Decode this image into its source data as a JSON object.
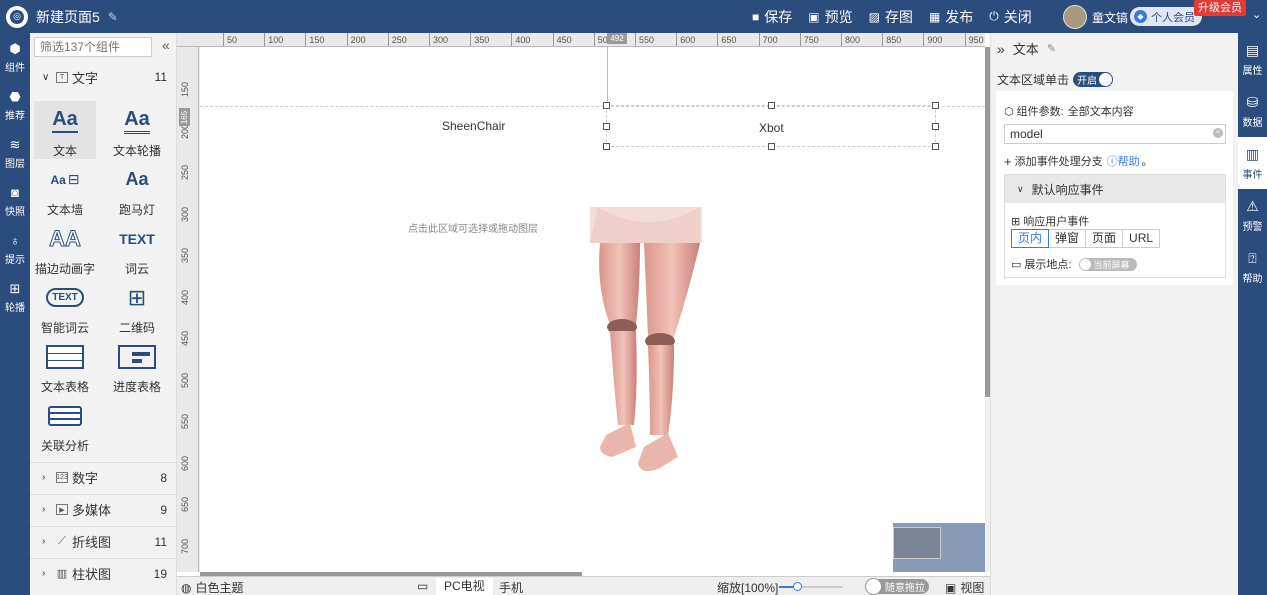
{
  "topbar": {
    "title": "新建页面5",
    "actions": [
      {
        "label": "保存",
        "icon": "save-icon"
      },
      {
        "label": "预览",
        "icon": "preview-icon"
      },
      {
        "label": "存图",
        "icon": "image-icon"
      },
      {
        "label": "发布",
        "icon": "publish-icon"
      },
      {
        "label": "关闭",
        "icon": "power-icon"
      }
    ],
    "user_name": "童文镐",
    "member_label": "个人会员",
    "upgrade_label": "升级会员"
  },
  "left_rail": [
    {
      "label": "组件",
      "icon": "component-icon"
    },
    {
      "label": "推荐",
      "icon": "recommend-icon"
    },
    {
      "label": "图层",
      "icon": "layers-icon"
    },
    {
      "label": "快照",
      "icon": "camera-icon"
    },
    {
      "label": "提示",
      "icon": "bulb-icon"
    },
    {
      "label": "轮播",
      "icon": "grid-icon"
    }
  ],
  "components": {
    "search_placeholder": "筛选137个组件",
    "expanded_category": {
      "label": "文字",
      "count": "11"
    },
    "items": [
      {
        "label": "文本",
        "glyph": "Aa"
      },
      {
        "label": "文本轮播",
        "glyph": "Aa"
      },
      {
        "label": "文本墙",
        "glyph": "Aa"
      },
      {
        "label": "跑马灯",
        "glyph": "Aa"
      },
      {
        "label": "描边动画字",
        "glyph": "AA"
      },
      {
        "label": "词云",
        "glyph": "TEXT"
      },
      {
        "label": "智能词云",
        "glyph": "TEXT"
      },
      {
        "label": "二维码",
        "glyph": "QR"
      },
      {
        "label": "文本表格",
        "glyph": ""
      },
      {
        "label": "进度表格",
        "glyph": ""
      },
      {
        "label": "关联分析",
        "glyph": ""
      }
    ],
    "collapsed_categories": [
      {
        "label": "数字",
        "count": "8"
      },
      {
        "label": "多媒体",
        "count": "9"
      },
      {
        "label": "折线图",
        "count": "11"
      },
      {
        "label": "柱状图",
        "count": "19"
      }
    ]
  },
  "rulers": {
    "top_labels": [
      "50",
      "100",
      "150",
      "200",
      "250",
      "300",
      "350",
      "400",
      "450",
      "500",
      "550",
      "600",
      "650",
      "700",
      "750",
      "800",
      "850",
      "900",
      "950"
    ],
    "left_labels": [
      "150",
      "200",
      "250",
      "300",
      "350",
      "400",
      "450",
      "500",
      "550",
      "600",
      "650",
      "700"
    ],
    "top_marker": "492",
    "left_marker": "165"
  },
  "canvas": {
    "text_left": "SheenChair",
    "text_right": "Xbot",
    "hint": "点击此区域可选择或拖动图层"
  },
  "statusbar": {
    "theme": "白色主题",
    "tab_pc": "PC电视",
    "tab_mobile": "手机",
    "zoom": "缩放[100%]",
    "drag": "随意拖拉",
    "view": "视图"
  },
  "properties": {
    "title": "文本",
    "click_label": "文本区域单击",
    "click_toggle": "开启",
    "param_label": "组件参数:",
    "param_value": "全部文本内容",
    "input_value": "model",
    "add_branch": "添加事件处理分支",
    "help": "帮助",
    "default_event": "默认响应事件",
    "respond_label": "响应用户事件",
    "respond_options": [
      "页内",
      "弹窗",
      "页面",
      "URL"
    ],
    "show_label": "展示地点:",
    "show_toggle": "当前屏幕"
  },
  "right_rail": [
    {
      "label": "属性",
      "icon": "property-icon"
    },
    {
      "label": "数据",
      "icon": "database-icon"
    },
    {
      "label": "事件",
      "icon": "event-icon"
    },
    {
      "label": "预警",
      "icon": "alarm-icon"
    },
    {
      "label": "帮助",
      "icon": "help-icon"
    }
  ]
}
